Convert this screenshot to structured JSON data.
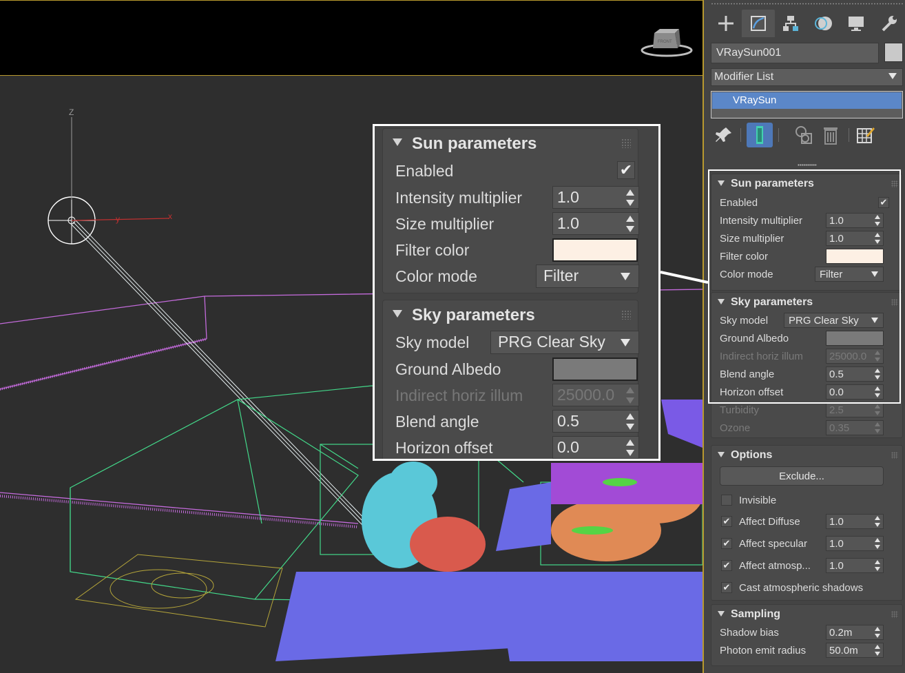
{
  "panel": {
    "object_name": "VRaySun001",
    "object_color": "#c9c9c9",
    "modifier_list": "Modifier List",
    "stack_item": "VRaySun",
    "accent": "#5b87c8",
    "tabs": [
      "create-icon",
      "modify-icon",
      "hierarchy-icon",
      "motion-icon",
      "display-icon",
      "utilities-icon"
    ],
    "stack_tools": [
      "pin-stack-icon",
      "show-end-result-icon",
      "make-unique-icon",
      "remove-modifier-icon",
      "configure-sets-icon"
    ]
  },
  "sun": {
    "title": "Sun parameters",
    "enabled_label": "Enabled",
    "enabled_mark": "✔",
    "intensity_label": "Intensity multiplier",
    "intensity_value": "1.0",
    "size_label": "Size multiplier",
    "size_value": "1.0",
    "filter_label": "Filter color",
    "filter_color": "#fdf0e4",
    "colormode_label": "Color mode",
    "colormode_value": "Filter"
  },
  "sky": {
    "title": "Sky parameters",
    "model_label": "Sky model",
    "model_value": "PRG Clear Sky",
    "albedo_label": "Ground Albedo",
    "albedo_color": "#7a7a7a",
    "indirect_label": "Indirect horiz illum",
    "indirect_value": "25000.0",
    "blend_label": "Blend angle",
    "blend_value": "0.5",
    "horizon_label": "Horizon offset",
    "horizon_value": "0.0",
    "turbidity_label": "Turbidity",
    "turbidity_value": "2.5",
    "ozone_label": "Ozone",
    "ozone_value": "0.35"
  },
  "options": {
    "title": "Options",
    "exclude_label": "Exclude...",
    "invisible_label": "Invisible",
    "diffuse_label": "Affect Diffuse",
    "diffuse_value": "1.0",
    "specular_label": "Affect specular",
    "specular_value": "1.0",
    "atmos_label": "Affect atmosp...",
    "atmos_value": "1.0",
    "cast_label": "Cast atmospheric shadows",
    "check_mark": "✔"
  },
  "sampling": {
    "title": "Sampling",
    "bias_label": "Shadow bias",
    "bias_value": "0.2m",
    "radius_label": "Photon emit radius",
    "radius_value": "50.0m"
  },
  "viewport": {
    "axis_z": "Z",
    "axis_y": "y",
    "axis_x": "x",
    "viewcube_label": "FRONT",
    "frame_color": "#b99a2e"
  }
}
